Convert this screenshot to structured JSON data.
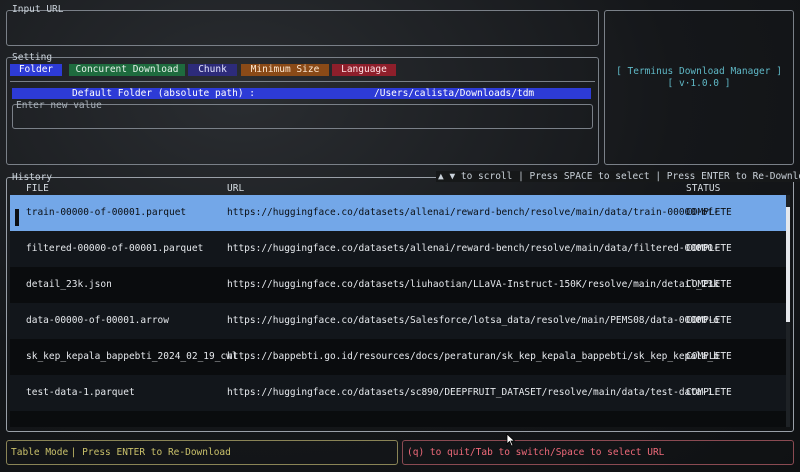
{
  "input_url": {
    "label": "Input URL",
    "value": ""
  },
  "setting": {
    "label": "Setting",
    "tabs": [
      {
        "label": "Folder",
        "bg": "#2d3bd6",
        "fg": "#ffffff"
      },
      {
        "label": "Concurent Download",
        "bg": "#1e6b3e",
        "fg": "#e6f2ea"
      },
      {
        "label": "Chunk",
        "bg": "#2d2b7a",
        "fg": "#e6e6ff"
      },
      {
        "label": "Minimum Size",
        "bg": "#8a4a17",
        "fg": "#ffe9d2"
      },
      {
        "label": "Language",
        "bg": "#8e1f2b",
        "fg": "#ffe3e6"
      }
    ],
    "field_label": "Default Folder (absolute path) :",
    "field_value": "/Users/calista/Downloads/tdm",
    "new_value_label": "Enter new value",
    "new_value": ""
  },
  "app_info": {
    "title": "[ Terminus Download Manager ]",
    "version": "[ v·1.0.0 ]"
  },
  "history": {
    "label": "History",
    "scroll_hint": "▲ ▼  to scroll | Press SPACE to select | Press ENTER to Re-Download",
    "columns": [
      "FILE",
      "URL",
      "STATUS"
    ],
    "rows": [
      {
        "file": "train-00000-of-00001.parquet",
        "url": "https://huggingface.co/datasets/allenai/reward-bench/resolve/main/data/train-00000-of-",
        "status": "COMPLETE"
      },
      {
        "file": "filtered-00000-of-00001.parquet",
        "url": "https://huggingface.co/datasets/allenai/reward-bench/resolve/main/data/filtered-00000-",
        "status": "COMPLETE"
      },
      {
        "file": "detail_23k.json",
        "url": "https://huggingface.co/datasets/liuhaotian/LLaVA-Instruct-150K/resolve/main/detail_23k",
        "status": "COMPLETE"
      },
      {
        "file": "data-00000-of-00001.arrow",
        "url": "https://huggingface.co/datasets/Salesforce/lotsa_data/resolve/main/PEMS08/data-00000-o",
        "status": "COMPLETE"
      },
      {
        "file": "sk_kep_kepala_bappebti_2024_02_19_cwl",
        "url": "https://bappebti.go.id/resources/docs/peraturan/sk_kep_kepala_bappebti/sk_kep_kepala_b",
        "status": "COMPLETE"
      },
      {
        "file": "test-data-1.parquet",
        "url": "https://huggingface.co/datasets/sc890/DEEPFRUIT_DATASET/resolve/main/data/test-data-1.",
        "status": "COMPLETE"
      }
    ],
    "selected_row": 0
  },
  "status_bar": {
    "mode": "Table Mode",
    "mode_hint": " | Press ENTER to Re-Download",
    "keys_hint": "(q) to quit/Tab to switch/Space to select URL"
  },
  "colors": {
    "selected_row_bg": "#73a7e8",
    "mode_text": "#c9c06a",
    "keys_text": "#ef6a7a",
    "info_text": "#5fb8c6"
  }
}
